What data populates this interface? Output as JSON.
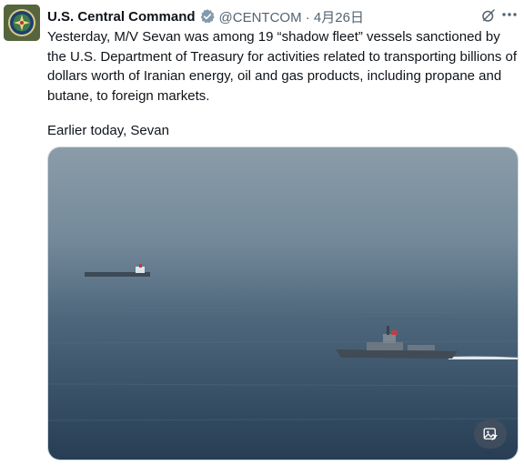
{
  "account": {
    "display_name": "U.S. Central Command",
    "handle_date": "@CENTCOM · 4月26日",
    "verified_icon": "verified-badge-icon",
    "avatar_icon": "centcom-seal-icon"
  },
  "header_icons": {
    "grok": "grok-icon",
    "more": "more-options-icon"
  },
  "tweet": {
    "paragraph_1": "Yesterday, M/V Sevan was among 19 “shadow fleet” vessels sanctioned by the U.S. Department of Treasury for activities related to transporting billions of dollars worth of Iranian energy, oil and gas products, including propane and butane, to foreign markets.",
    "paragraph_2": "Earlier today, Sevan"
  },
  "media": {
    "description_icon": "image-alt-icon"
  },
  "colors": {
    "text": "#0f1419",
    "secondary": "#536471",
    "verified": "#829aab",
    "sea_top": "#8296a3",
    "sea_bottom": "#273f55"
  }
}
